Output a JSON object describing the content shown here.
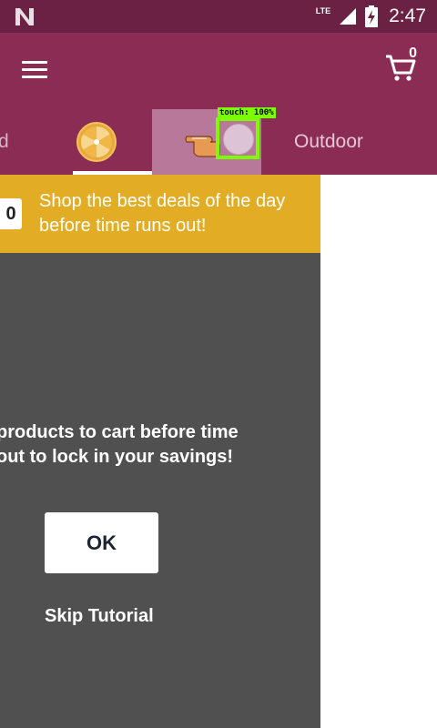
{
  "status_bar": {
    "network": "LTE",
    "time": "2:47"
  },
  "app_bar": {
    "menu_icon": "hamburger-menu-icon",
    "cart_icon": "shopping-cart-icon",
    "cart_count": "0"
  },
  "tabs": {
    "partial_label": "d",
    "deals_icon": "deals-wheel-icon",
    "outdoor_label": "Outdoor"
  },
  "touch_overlay": {
    "label": "touch: 100%"
  },
  "banner": {
    "timer_digit": "0",
    "text": "Shop the best deals of the day before time runs out!"
  },
  "tutorial": {
    "message_line1": "products to cart before time",
    "message_line2": "out to lock in your savings!",
    "ok_label": "OK",
    "skip_label": "Skip Tutorial"
  },
  "colors": {
    "status_bar": "#6b2143",
    "app_bar": "#8b2c55",
    "banner": "#e2ad25",
    "overlay": "#505050"
  }
}
